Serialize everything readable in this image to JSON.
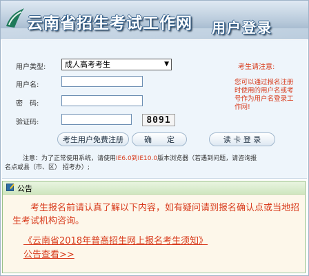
{
  "header": {
    "site_title": "云南省招生考试工作网",
    "login_title": "用户登录"
  },
  "form": {
    "user_type_label": "用户类型:",
    "user_type_value": "成人高考考生",
    "username_label": "用户名:",
    "username_value": "",
    "password_label": "密　码:",
    "password_value": "",
    "captcha_label": "验证码:",
    "captcha_value": "",
    "captcha_code": "8091"
  },
  "buttons": {
    "register": "考生用户免费注册",
    "confirm": "确　　定",
    "card_login": "读 卡 登 录"
  },
  "notes": {
    "title": "考生请注意:",
    "text": "您可以通过报名注册时使用的用户名或考号作为用户名登录工作网!"
  },
  "browser_notice": {
    "prefix": "注意：为了正常使用系统，请使用",
    "browsers": "IE6.0到IE10.0",
    "suffix": "版本浏览器（若遇到问题，请咨询报",
    "line2": "名点或县（市、区） 招考办）;"
  },
  "announcement": {
    "title": "公告",
    "text": "考生报名前请认真了解以下内容，如有疑问请到报名确认点或当地招生考试机构咨询。",
    "link1": "《云南省2018年普高招生网上报名考生须知》",
    "link2": "公告查看>>"
  },
  "colors": {
    "accent_red": "#d83a1b",
    "header_blue": "#8ea7bf",
    "panel_bg": "#eef5fb"
  }
}
